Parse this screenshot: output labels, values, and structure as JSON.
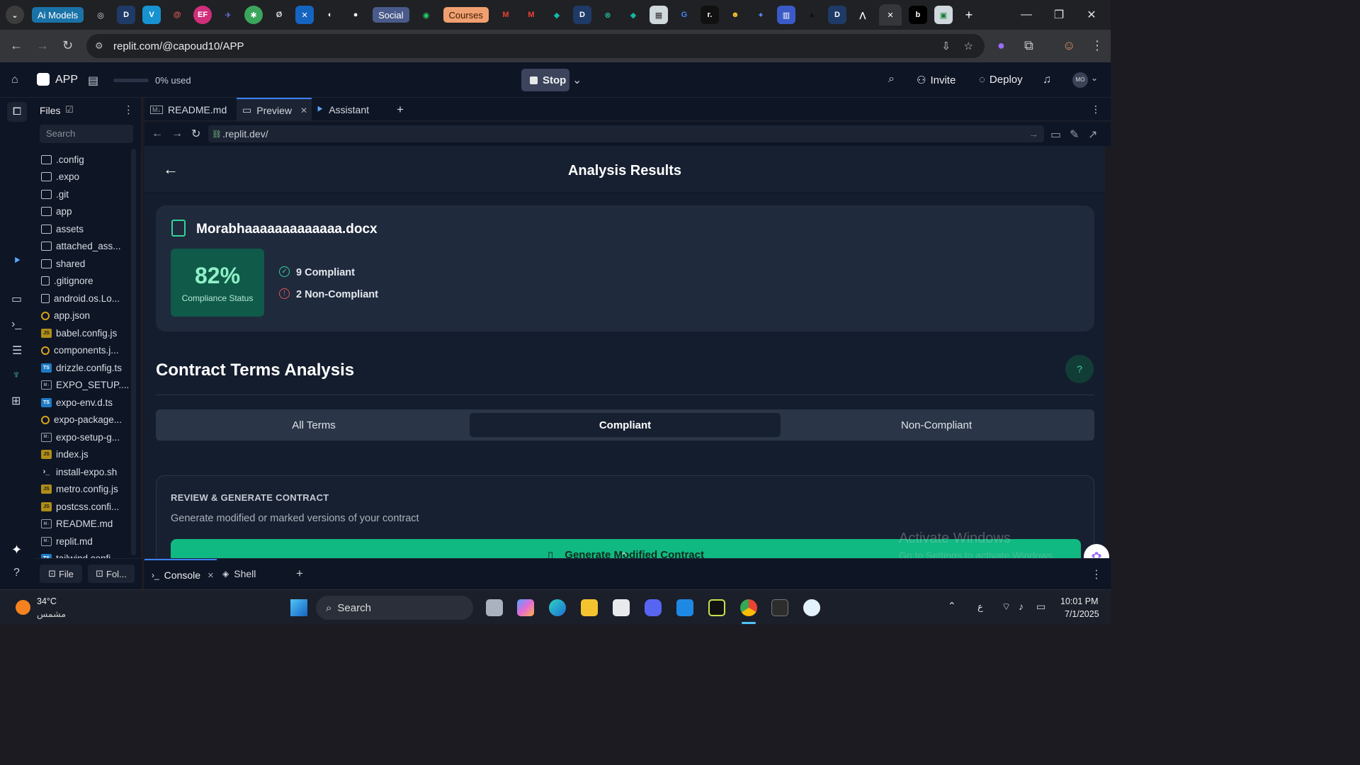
{
  "browser": {
    "tab_chips": [
      "Ai Models",
      "Social",
      "Courses"
    ],
    "active_tab_close": "✕",
    "new_tab": "+",
    "window_controls": [
      "—",
      "❐",
      "✕"
    ],
    "url": "replit.com/@capoud10/APP"
  },
  "replit": {
    "app_name": "APP",
    "usage": "0% used",
    "stop_label": "Stop",
    "invite_label": "Invite",
    "deploy_label": "Deploy",
    "avatar_initials": "MO",
    "files_title": "Files",
    "search_placeholder": "Search",
    "files": [
      {
        "name": ".config",
        "type": "folder"
      },
      {
        "name": ".expo",
        "type": "folder"
      },
      {
        "name": ".git",
        "type": "folder"
      },
      {
        "name": "app",
        "type": "folder"
      },
      {
        "name": "assets",
        "type": "folder"
      },
      {
        "name": "attached_ass...",
        "type": "folder"
      },
      {
        "name": "shared",
        "type": "folder"
      },
      {
        "name": ".gitignore",
        "type": "doc"
      },
      {
        "name": "android.os.Lo...",
        "type": "doc"
      },
      {
        "name": "app.json",
        "type": "json"
      },
      {
        "name": "babel.config.js",
        "type": "js"
      },
      {
        "name": "components.j...",
        "type": "json"
      },
      {
        "name": "drizzle.config.ts",
        "type": "ts"
      },
      {
        "name": "EXPO_SETUP....",
        "type": "md"
      },
      {
        "name": "expo-env.d.ts",
        "type": "ts"
      },
      {
        "name": "expo-package...",
        "type": "json"
      },
      {
        "name": "expo-setup-g...",
        "type": "md"
      },
      {
        "name": "index.js",
        "type": "js"
      },
      {
        "name": "install-expo.sh",
        "type": "sh"
      },
      {
        "name": "metro.config.js",
        "type": "js"
      },
      {
        "name": "postcss.confi...",
        "type": "js"
      },
      {
        "name": "README.md",
        "type": "md"
      },
      {
        "name": "replit.md",
        "type": "md"
      },
      {
        "name": "tailwind.confi...",
        "type": "ts"
      }
    ],
    "file_button": "File",
    "folder_button": "Fol...",
    "editor_tabs": [
      "README.md",
      "Preview",
      "Assistant"
    ],
    "preview_url": ".replit.dev/",
    "bottom_tabs": [
      "Console",
      "Shell"
    ]
  },
  "app": {
    "header_title": "Analysis Results",
    "file_name": "Morabhaaaaaaaaaaaaa.docx",
    "score": "82%",
    "score_label": "Compliance Status",
    "compliant_count": "9 Compliant",
    "noncompliant_count": "2 Non-Compliant",
    "section_title": "Contract Terms Analysis",
    "filter_tabs": [
      "All Terms",
      "Compliant",
      "Non-Compliant"
    ],
    "selected_filter": "Compliant",
    "review_heading": "REVIEW & GENERATE CONTRACT",
    "review_sub": "Generate modified or marked versions of your contract",
    "generate_label": "Generate Modified Contract",
    "watermark_title": "Activate Windows",
    "watermark_sub": "Go to Settings to activate Windows."
  },
  "taskbar": {
    "weather_temp": "34°C",
    "weather_desc": "مشمس",
    "search_label": "Search",
    "lang": "ع",
    "time": "10:01 PM",
    "date": "7/1/2025"
  },
  "colors": {
    "accent_green": "#10b981",
    "score_bg": "#0f5a48",
    "noncompliant_red": "#e05454"
  }
}
